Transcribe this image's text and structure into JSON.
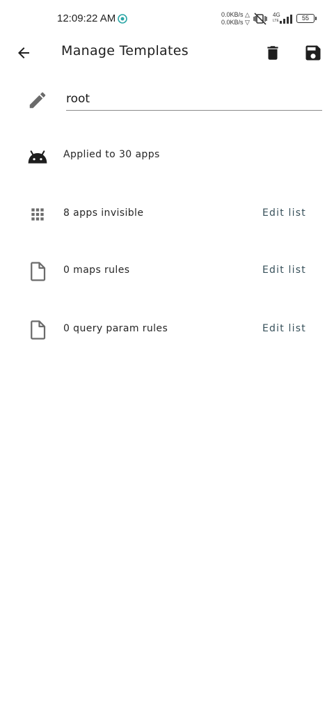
{
  "status_bar": {
    "time": "12:09:22 AM",
    "net_up": "0.0KB/s",
    "net_down": "0.0KB/s",
    "net_type_top": "4G",
    "net_type_bottom": "LTE",
    "battery": "55"
  },
  "toolbar": {
    "title": "Manage Templates",
    "back_icon": "arrow-back-icon",
    "delete_icon": "trash-icon",
    "save_icon": "floppy-save-icon"
  },
  "template": {
    "name_value": "root",
    "name_icon": "pencil-icon",
    "applied_text": "Applied to 30 apps",
    "applied_icon": "android-icon"
  },
  "rules": [
    {
      "icon": "app-grid-icon",
      "text": "8 apps invisible",
      "action": "Edit list"
    },
    {
      "icon": "document-icon",
      "text": "0 maps rules",
      "action": "Edit list"
    },
    {
      "icon": "document-icon",
      "text": "0 query param rules",
      "action": "Edit list"
    }
  ],
  "colors": {
    "icon_gray": "#6b6b6b",
    "icon_dark": "#1e1e1e",
    "link": "#37505a",
    "sync_accent": "#2aa6a6"
  }
}
